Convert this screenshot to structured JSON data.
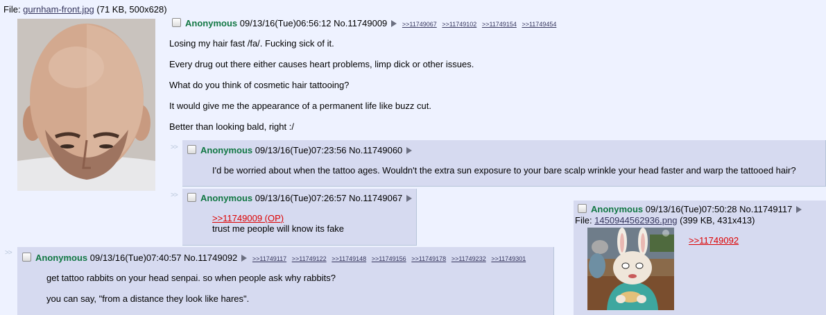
{
  "op": {
    "file_prefix": "File: ",
    "file_name": "gurnham-front.jpg",
    "file_info": " (71 KB, 500x628)",
    "name": "Anonymous",
    "datetime": "09/13/16(Tue)06:56:12",
    "no": "No.11749009",
    "backlinks": [
      ">>11749067",
      ">>11749102",
      ">>11749154",
      ">>11749454"
    ],
    "lines": [
      "Losing my hair fast /fa/. Fucking sick of it.",
      "Every drug out there either causes heart problems, limp dick or other issues.",
      "What do you think of cosmetic hair tattooing?",
      "It would give me the appearance of a permanent life like buzz cut.",
      "Better than looking bald, right :/"
    ]
  },
  "reply_prefix": ">>",
  "replies": {
    "r1": {
      "name": "Anonymous",
      "datetime": "09/13/16(Tue)07:23:56",
      "no": "No.11749060",
      "text": "I'd be worried about when the tattoo ages. Wouldn't the extra sun exposure to your bare scalp wrinkle your head faster and warp the tattooed hair?"
    },
    "r2": {
      "name": "Anonymous",
      "datetime": "09/13/16(Tue)07:26:57",
      "no": "No.11749067",
      "quote": ">>11749009 (OP)",
      "text": "trust me people will know its fake"
    },
    "r3": {
      "name": "Anonymous",
      "datetime": "09/13/16(Tue)07:40:57",
      "no": "No.11749092",
      "backlinks": [
        ">>11749117",
        ">>11749122",
        ">>11749148",
        ">>11749156",
        ">>11749178",
        ">>11749232",
        ">>11749301"
      ],
      "lines": [
        "get tattoo rabbits on your head senpai. so when people ask why rabbits?",
        "you can say, \"from a distance they look like hares\"."
      ]
    },
    "r4": {
      "name": "Anonymous",
      "datetime": "09/13/16(Tue)07:50:28",
      "no": "No.11749117",
      "file_prefix": "File: ",
      "file_name": "1450944562936.png",
      "file_info": " (399 KB, 431x413)",
      "quote": ">>11749092"
    }
  },
  "colors": {
    "background": "#eef2ff",
    "reply_bg": "#d6daf0",
    "name": "#117743",
    "quotelink": "#dd0000"
  }
}
